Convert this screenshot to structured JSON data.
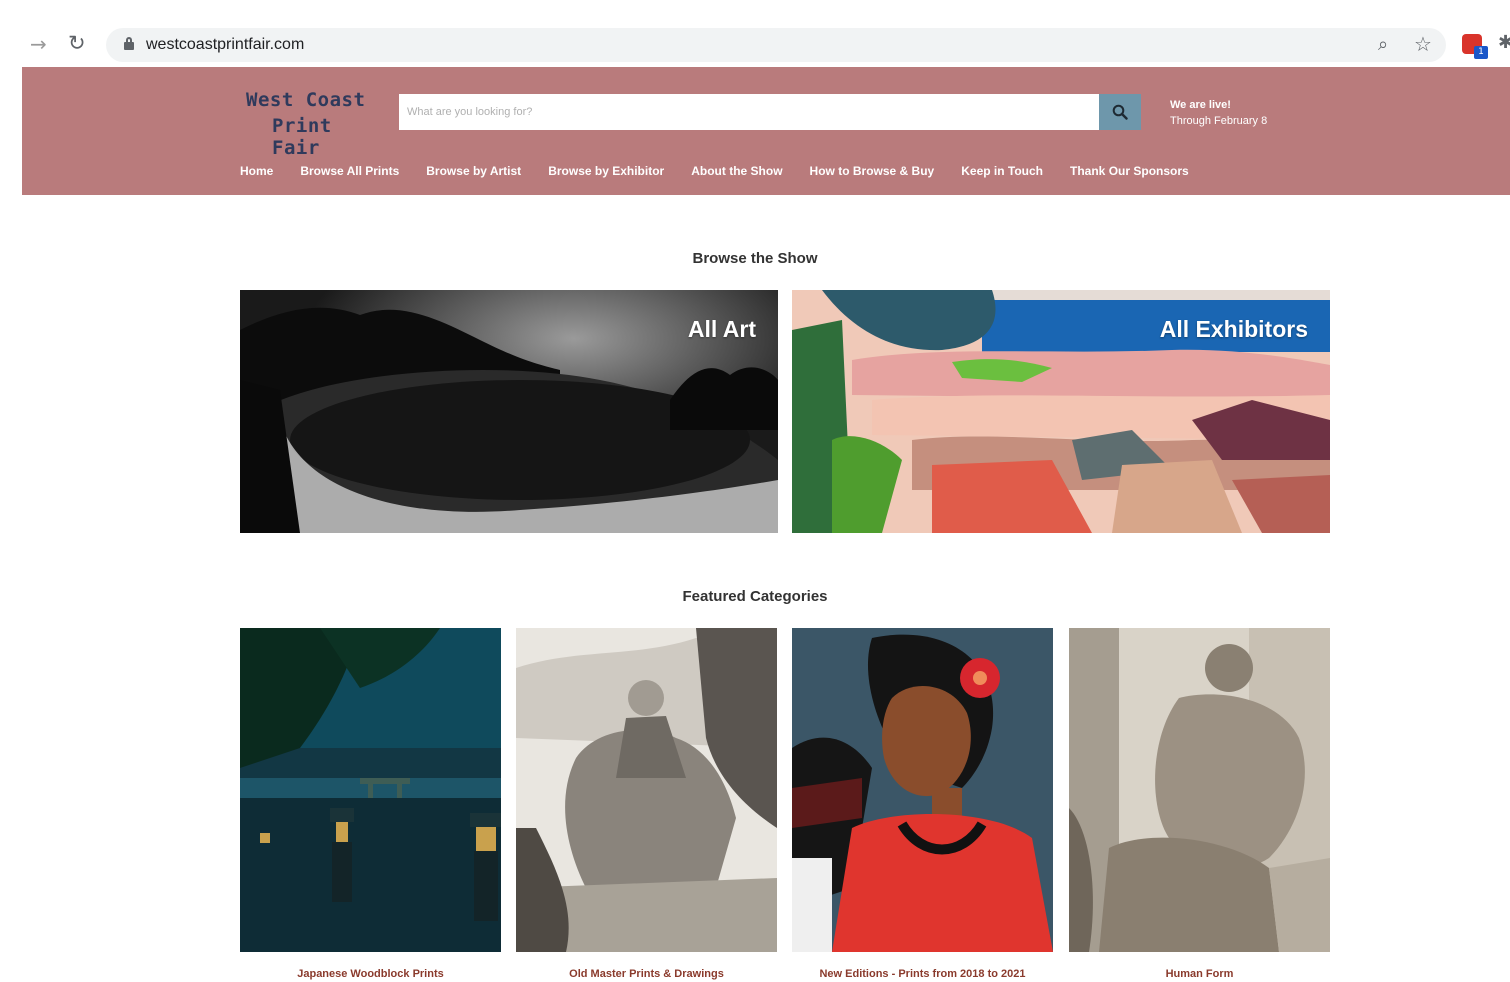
{
  "browser": {
    "url": "westcoastprintfair.com",
    "extension_badge": "1"
  },
  "header": {
    "logo_line1": "West Coast",
    "logo_line2": "Print Fair",
    "search_placeholder": "What are you looking for?",
    "live_line1": "We are live!",
    "live_line2": "Through February 8",
    "nav": [
      "Home",
      "Browse All Prints",
      "Browse by Artist",
      "Browse by Exhibitor",
      "About the Show",
      "How to Browse & Buy",
      "Keep in Touch",
      "Thank Our Sponsors"
    ]
  },
  "browse": {
    "title": "Browse the Show",
    "tiles": [
      "All Art",
      "All Exhibitors"
    ]
  },
  "featured": {
    "title": "Featured Categories",
    "categories": [
      "Japanese Woodblock Prints",
      "Old Master Prints & Drawings",
      "New Editions - Prints from 2018 to 2021",
      "Human Form"
    ]
  },
  "colors": {
    "header_bg": "#b97b7c",
    "logo_text": "#2f3a5c",
    "search_button": "#6e97ab",
    "category_label": "#8a3a2c"
  }
}
